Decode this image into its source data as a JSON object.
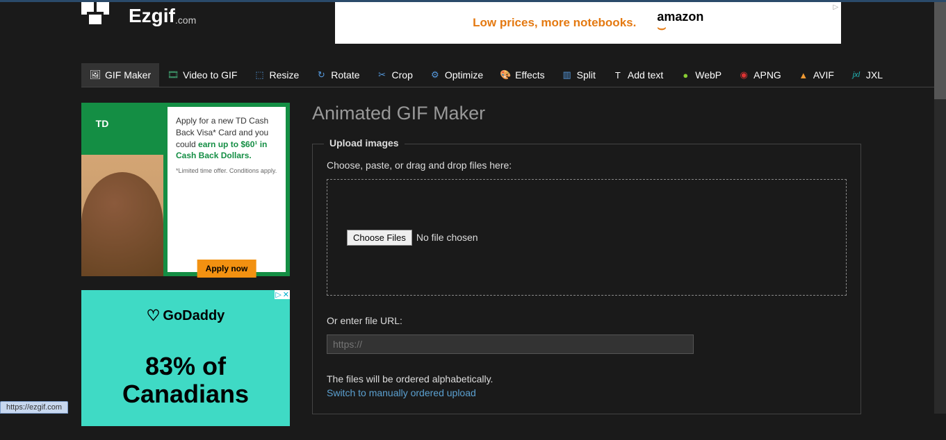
{
  "logo": {
    "name": "Ezgif",
    "suffix": ".com"
  },
  "top_ad": {
    "text": "Low prices, more notebooks.",
    "brand": "amazon",
    "marker": "▷"
  },
  "nav": [
    {
      "label": "GIF Maker",
      "icon": "🖼"
    },
    {
      "label": "Video to GIF",
      "icon": "🎞"
    },
    {
      "label": "Resize",
      "icon": "⬚"
    },
    {
      "label": "Rotate",
      "icon": "↻"
    },
    {
      "label": "Crop",
      "icon": "✂"
    },
    {
      "label": "Optimize",
      "icon": "⚙"
    },
    {
      "label": "Effects",
      "icon": "🎨"
    },
    {
      "label": "Split",
      "icon": "▥"
    },
    {
      "label": "Add text",
      "icon": "T"
    },
    {
      "label": "WebP",
      "icon": "●"
    },
    {
      "label": "APNG",
      "icon": "◉"
    },
    {
      "label": "AVIF",
      "icon": "▲"
    },
    {
      "label": "JXL",
      "icon": "jxl"
    }
  ],
  "ad1": {
    "badge": "TD",
    "line1": "Apply for a new TD Cash Back Visa* Card and you could ",
    "line2": "earn up to $60¹ in Cash Back Dollars.",
    "small": "*Limited time offer. Conditions apply.",
    "button": "Apply now",
    "close_marker": "▷",
    "close_x": "✕"
  },
  "ad2": {
    "brand": "GoDaddy",
    "text": "83% of",
    "text2": "Canadians",
    "close_marker": "▷",
    "close_x": "✕"
  },
  "page": {
    "title": "Animated GIF Maker",
    "fieldset_legend": "Upload images",
    "choose_label": "Choose, paste, or drag and drop files here:",
    "file_button": "Choose Files",
    "file_status": "No file chosen",
    "url_label": "Or enter file URL:",
    "url_placeholder": "https://",
    "info": "The files will be ordered alphabetically.",
    "switch_link": "Switch to manually ordered upload"
  },
  "status_url": "https://ezgif.com"
}
